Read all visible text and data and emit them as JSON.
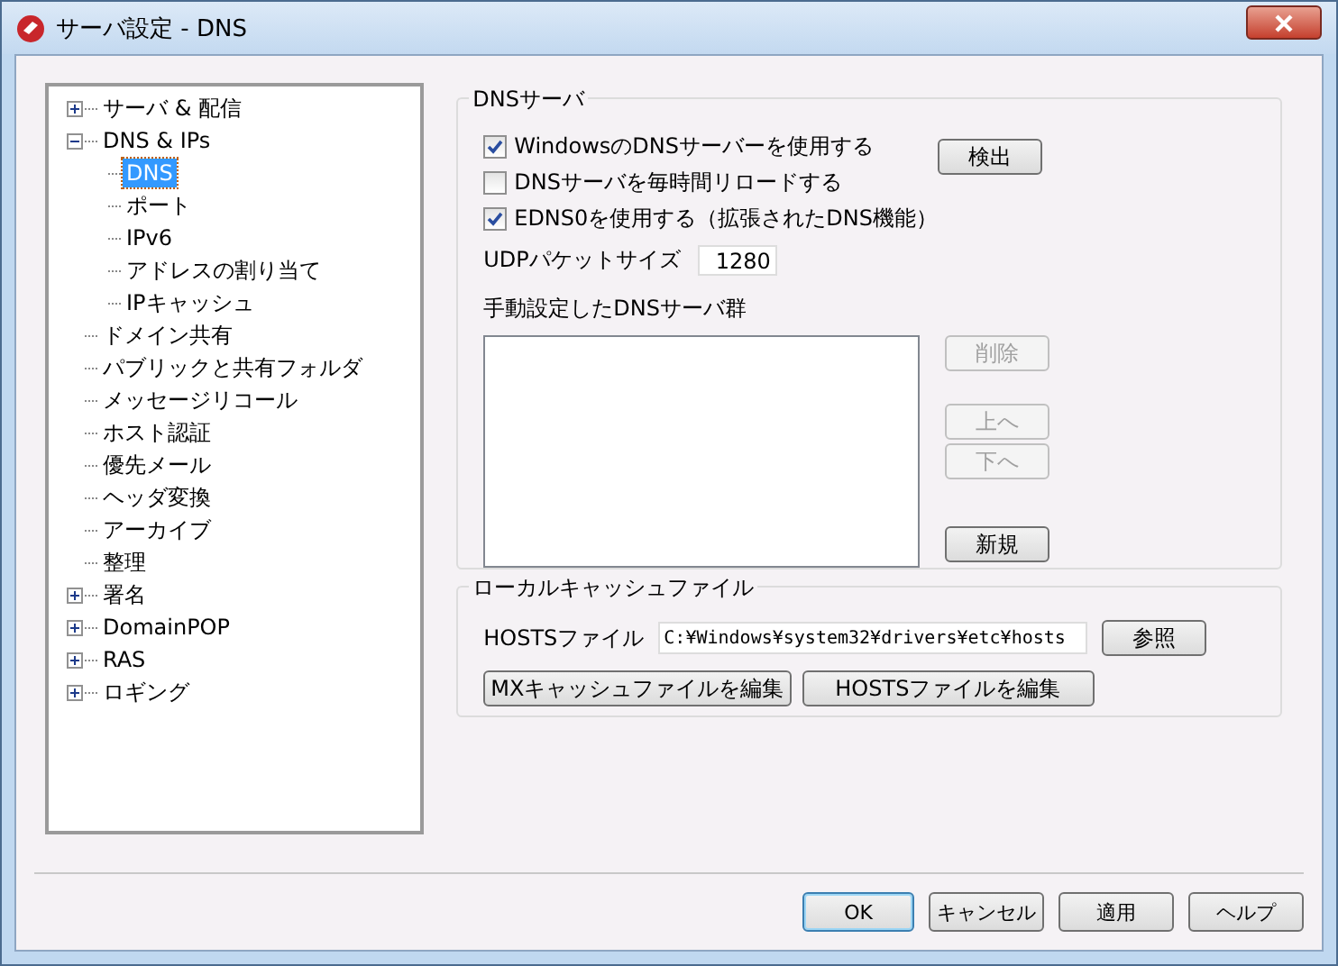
{
  "window": {
    "title": "サーバ設定 - DNS"
  },
  "tree": [
    {
      "label": "サーバ & 配信",
      "kind": "group",
      "expanded": false,
      "selected": false
    },
    {
      "label": "DNS & IPs",
      "kind": "group",
      "expanded": true,
      "selected": false,
      "children": [
        {
          "label": "DNS",
          "selected": true
        },
        {
          "label": "ポート",
          "selected": false
        },
        {
          "label": "IPv6",
          "selected": false
        },
        {
          "label": "アドレスの割り当て",
          "selected": false
        },
        {
          "label": "IPキャッシュ",
          "selected": false
        }
      ]
    },
    {
      "label": "ドメイン共有",
      "kind": "leaf",
      "selected": false
    },
    {
      "label": "パブリックと共有フォルダ",
      "kind": "leaf",
      "selected": false
    },
    {
      "label": "メッセージリコール",
      "kind": "leaf",
      "selected": false
    },
    {
      "label": "ホスト認証",
      "kind": "leaf",
      "selected": false
    },
    {
      "label": "優先メール",
      "kind": "leaf",
      "selected": false
    },
    {
      "label": "ヘッダ変換",
      "kind": "leaf",
      "selected": false
    },
    {
      "label": "アーカイブ",
      "kind": "leaf",
      "selected": false
    },
    {
      "label": "整理",
      "kind": "leaf",
      "selected": false
    },
    {
      "label": "署名",
      "kind": "group",
      "expanded": false,
      "selected": false
    },
    {
      "label": "DomainPOP",
      "kind": "group",
      "expanded": false,
      "selected": false
    },
    {
      "label": "RAS",
      "kind": "group",
      "expanded": false,
      "selected": false
    },
    {
      "label": "ロギング",
      "kind": "group",
      "expanded": false,
      "selected": false
    }
  ],
  "dns_group": {
    "title": "DNSサーバ",
    "checkboxes": [
      {
        "label": "WindowsのDNSサーバーを使用する",
        "checked": true
      },
      {
        "label": "DNSサーバを毎時間リロードする",
        "checked": false
      },
      {
        "label": "EDNS0を使用する（拡張されたDNS機能）",
        "checked": true
      }
    ],
    "detect_button": "検出",
    "udp_label": "UDPパケットサイズ",
    "udp_value": "1280",
    "list_label": "手動設定したDNSサーバ群",
    "side_buttons": [
      {
        "label": "削除",
        "disabled": true
      },
      {
        "label": "上へ",
        "disabled": true
      },
      {
        "label": "下へ",
        "disabled": true
      },
      {
        "label": "新規",
        "disabled": false
      }
    ]
  },
  "cache_group": {
    "title": "ローカルキャッシュファイル",
    "hosts_label": "HOSTSファイル",
    "hosts_value": "C:¥Windows¥system32¥drivers¥etc¥hosts",
    "browse_button": "参照",
    "buttons": [
      "MXキャッシュファイルを編集",
      "HOSTSファイルを編集"
    ]
  },
  "footer_buttons": [
    {
      "label": "OK",
      "default": true
    },
    {
      "label": "キャンセル",
      "default": false
    },
    {
      "label": "適用",
      "default": false
    },
    {
      "label": "ヘルプ",
      "default": false
    }
  ]
}
